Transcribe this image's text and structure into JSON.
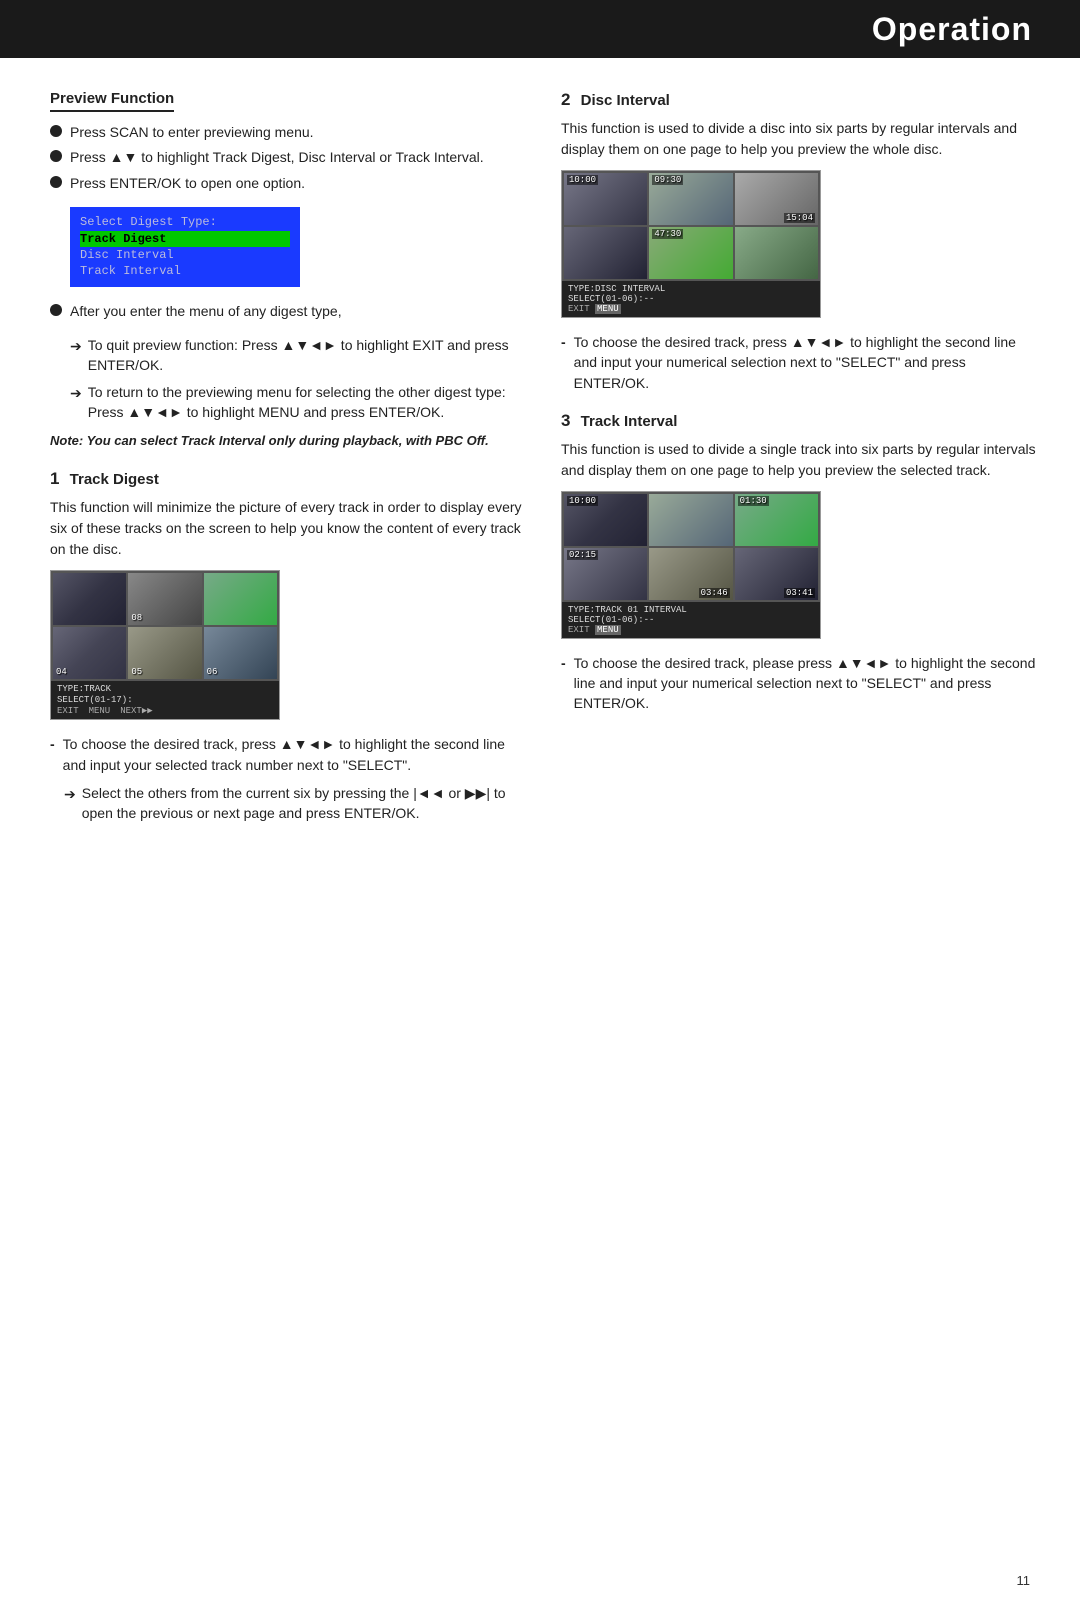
{
  "header": {
    "title": "Operation"
  },
  "left": {
    "preview_function": {
      "title": "Preview Function",
      "bullets": [
        "Press SCAN to enter previewing menu.",
        "Press ▲▼ to highlight Track Digest, Disc Interval or Track Interval.",
        "Press ENTER/OK to open one option."
      ],
      "menu_items": [
        {
          "label": "Select Digest Type:",
          "selected": false
        },
        {
          "label": "Track Digest",
          "selected": true
        },
        {
          "label": "Disc Interval",
          "selected": false
        },
        {
          "label": "Track Interval",
          "selected": false
        }
      ],
      "after_menu_text": "After you enter the menu of any digest type,",
      "arrows": [
        "To quit preview function: Press ▲▼◄► to highlight EXIT and press ENTER/OK.",
        "To return to the previewing menu for selecting the other digest type: Press ▲▼◄► to highlight MENU and press ENTER/OK."
      ],
      "note": "Note: You can select Track Interval only during playback, with PBC Off."
    },
    "track_digest": {
      "number": "1",
      "title": "Track Digest",
      "body": "This function will minimize the picture of every track in order to display every six of these tracks on the screen to help you know the content of every track on the disc.",
      "screenshot": {
        "cells": [
          {
            "label": "",
            "frame": "frame-1",
            "time": ""
          },
          {
            "label": "",
            "frame": "frame-2",
            "time": "08"
          },
          {
            "label": "",
            "frame": "frame-3",
            "time": ""
          },
          {
            "label": "04",
            "frame": "frame-4",
            "time": ""
          },
          {
            "label": "05",
            "frame": "frame-5",
            "time": ""
          },
          {
            "label": "06",
            "frame": "frame-6",
            "time": ""
          }
        ],
        "status1": "TYPE:TRACK",
        "status2": "SELECT(01-17):",
        "menu_items": [
          "EXIT",
          "MENU",
          "NEXT▶▶"
        ]
      },
      "dash_items": [
        "To choose the desired track, press ▲▼◄► to highlight the second line and input your selected track number next to \"SELECT\".",
        "Select the others from the current six by pressing the |◄◄ or ▶▶| to open the previous or next page and press ENTER/OK."
      ]
    }
  },
  "right": {
    "disc_interval": {
      "number": "2",
      "title": "Disc Interval",
      "body": "This function is used to divide a disc into six parts by regular intervals and display them on one page to help you preview the whole disc.",
      "screenshot": {
        "cells": [
          {
            "time_tl": "10:00",
            "frame": "frame-1b",
            "time": ""
          },
          {
            "time_tl": "09:30",
            "frame": "frame-2b",
            "time": ""
          },
          {
            "time_tl": "",
            "frame": "frame-3b",
            "time": "15:04"
          },
          {
            "time_tl": "",
            "frame": "frame-4b",
            "time": ""
          },
          {
            "time_tl": "47:30",
            "frame": "frame-5b",
            "time": ""
          },
          {
            "time_tl": "",
            "frame": "frame-6b",
            "time": ""
          }
        ],
        "status1": "TYPE:DISC INTERVAL",
        "status2": "SELECT(01-06):--",
        "menu_items": [
          "EXIT",
          "MENU"
        ]
      },
      "dash_items": [
        "To choose the desired track, press ▲▼◄► to highlight the second line and input your numerical selection next to \"SELECT\" and press ENTER/OK."
      ]
    },
    "track_interval": {
      "number": "3",
      "title": "Track Interval",
      "body": "This function is used to divide a single track into six parts by regular intervals and display them on one page to help you preview the selected track.",
      "screenshot": {
        "cells": [
          {
            "time_tl": "10:00",
            "frame": "frame-1",
            "time": ""
          },
          {
            "time_tl": "",
            "frame": "frame-2b",
            "time": ""
          },
          {
            "time_tl": "01:30",
            "frame": "frame-3",
            "time": ""
          },
          {
            "time_tl": "02:15",
            "frame": "frame-1b",
            "time": ""
          },
          {
            "time_tl": "",
            "frame": "frame-5",
            "time": "03:46"
          },
          {
            "time_tl": "",
            "frame": "frame-4b",
            "time": "03:41"
          }
        ],
        "status1": "TYPE:TRACK 01 INTERVAL",
        "status2": "SELECT(01-06):--",
        "menu_items": [
          "EXIT",
          "MENU"
        ]
      },
      "dash_items": [
        "To choose the desired track, please press ▲▼◄► to highlight the second line and input your numerical selection next to \"SELECT\" and press ENTER/OK."
      ]
    }
  },
  "page_number": "11"
}
